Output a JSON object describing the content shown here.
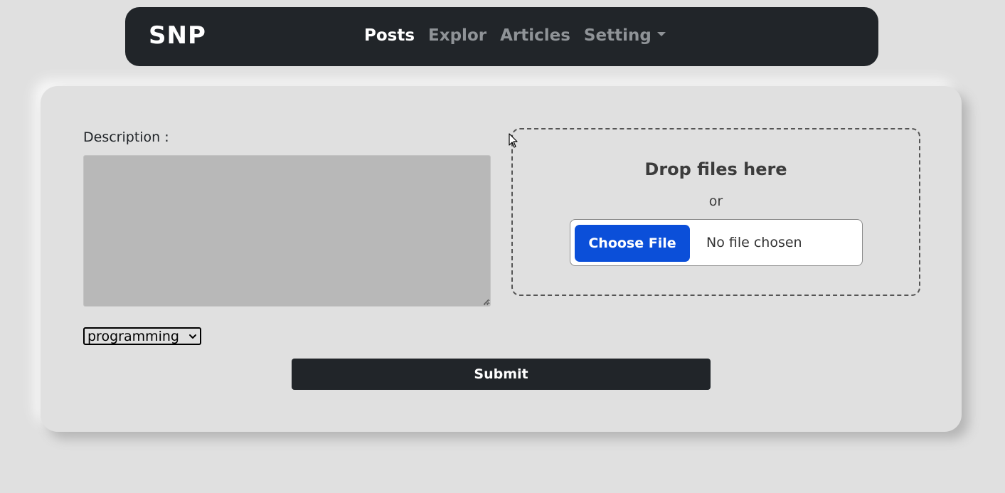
{
  "navbar": {
    "brand": "SNP",
    "links": [
      {
        "label": "Posts",
        "active": true
      },
      {
        "label": "Explor",
        "active": false
      },
      {
        "label": "Articles",
        "active": false
      },
      {
        "label": "Setting",
        "active": false,
        "dropdown": true
      }
    ]
  },
  "form": {
    "description_label": "Description :",
    "description_value": "",
    "dropzone": {
      "title": "Drop files here",
      "separator": "or",
      "choose_button": "Choose File",
      "file_status": "No file chosen"
    },
    "category_select": {
      "selected": "programming"
    },
    "submit_label": "Submit"
  },
  "colors": {
    "page_background": "#e0e0e0",
    "navbar_background": "#212529",
    "nav_active": "#ffffff",
    "nav_inactive": "#8f9397",
    "textarea_background": "#b8b8b8",
    "choose_button": "#0b4fd9",
    "submit_button": "#212529"
  },
  "icons": {
    "dropdown_caret": "caret-down-icon",
    "select_chevron": "chevron-down-icon",
    "mouse_cursor": "arrow-cursor-icon"
  }
}
